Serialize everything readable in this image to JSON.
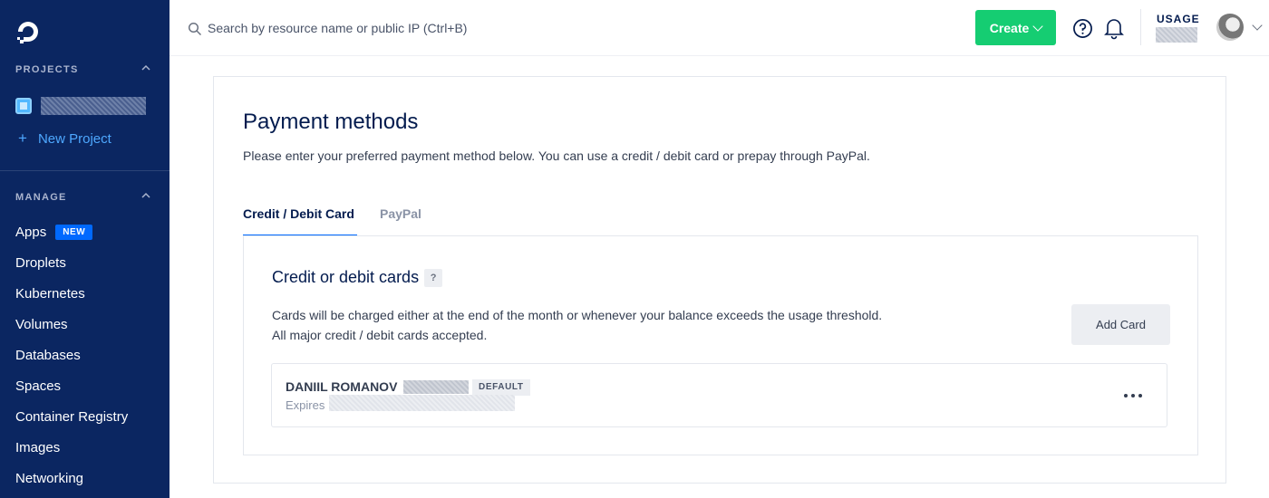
{
  "sidebar": {
    "projects_heading": "PROJECTS",
    "new_project_label": "New Project",
    "manage_heading": "MANAGE",
    "nav": [
      {
        "label": "Apps",
        "badge": "NEW"
      },
      {
        "label": "Droplets"
      },
      {
        "label": "Kubernetes"
      },
      {
        "label": "Volumes"
      },
      {
        "label": "Databases"
      },
      {
        "label": "Spaces"
      },
      {
        "label": "Container Registry"
      },
      {
        "label": "Images"
      },
      {
        "label": "Networking"
      }
    ]
  },
  "topbar": {
    "search_placeholder": "Search by resource name or public IP (Ctrl+B)",
    "create_label": "Create",
    "usage_label": "USAGE"
  },
  "main": {
    "title": "Payment methods",
    "description": "Please enter your preferred payment method below. You can use a credit / debit card or prepay through PayPal.",
    "tabs": [
      {
        "label": "Credit / Debit Card"
      },
      {
        "label": "PayPal"
      }
    ],
    "cards_section": {
      "title": "Credit or debit cards",
      "help": "?",
      "description": "Cards will be charged either at the end of the month or whenever your balance exceeds the usage threshold. All major credit / debit cards accepted.",
      "add_card_label": "Add Card",
      "card": {
        "holder": "DANIIL ROMANOV",
        "badge": "DEFAULT",
        "expires_label": "Expires"
      }
    }
  },
  "colors": {
    "sidebar_bg": "#0b2661",
    "create_green": "#15cd72",
    "accent_blue": "#0069ff"
  }
}
